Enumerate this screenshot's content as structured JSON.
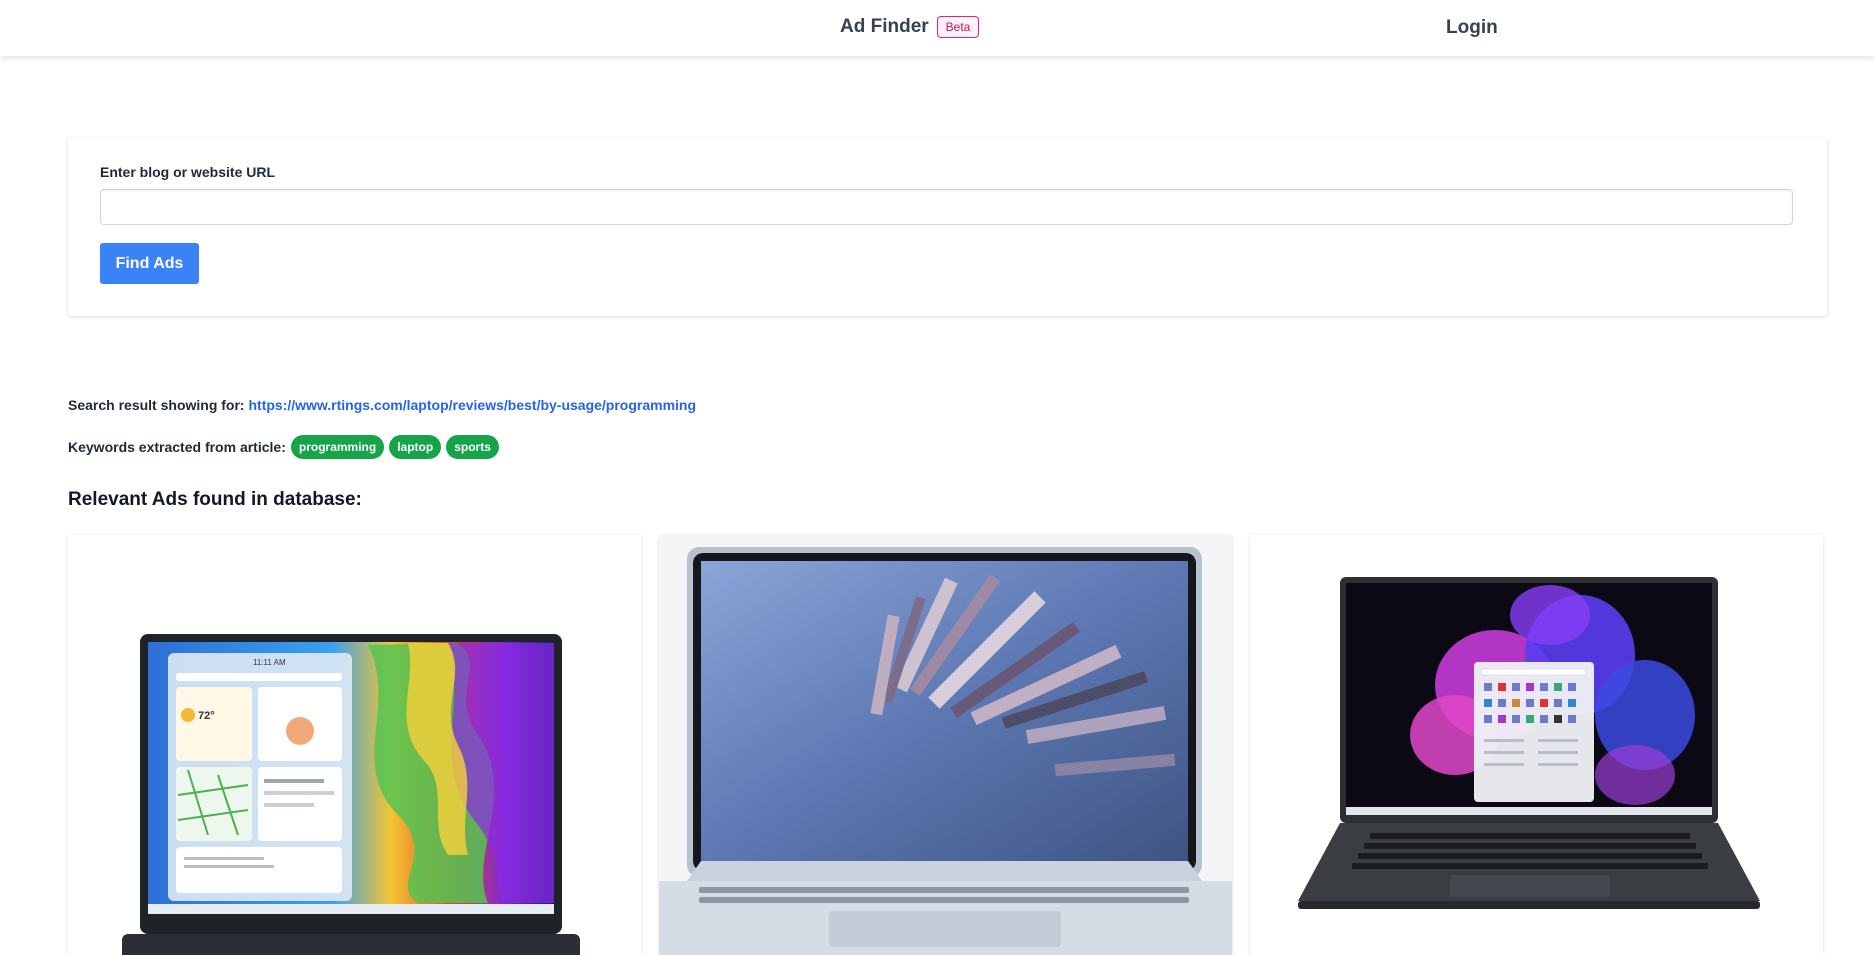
{
  "header": {
    "brand": "Ad Finder",
    "badge": "Beta",
    "login": "Login"
  },
  "form": {
    "label": "Enter blog or website URL",
    "input_value": "",
    "input_placeholder": "",
    "button_label": "Find Ads"
  },
  "results": {
    "showing_label": "Search result showing for:",
    "url": "https://www.rtings.com/laptop/reviews/best/by-usage/programming",
    "keywords_label": "Keywords extracted from article:",
    "keywords": [
      "programming",
      "laptop",
      "sports"
    ],
    "ads_heading": "Relevant Ads found in database:",
    "ad_time": "11:11 AM",
    "ad_temp": "72°"
  },
  "colors": {
    "primary_button": "#3b82f6",
    "link": "#2563eb",
    "keyword_badge": "#16a34a",
    "beta_badge": "#db2777"
  }
}
